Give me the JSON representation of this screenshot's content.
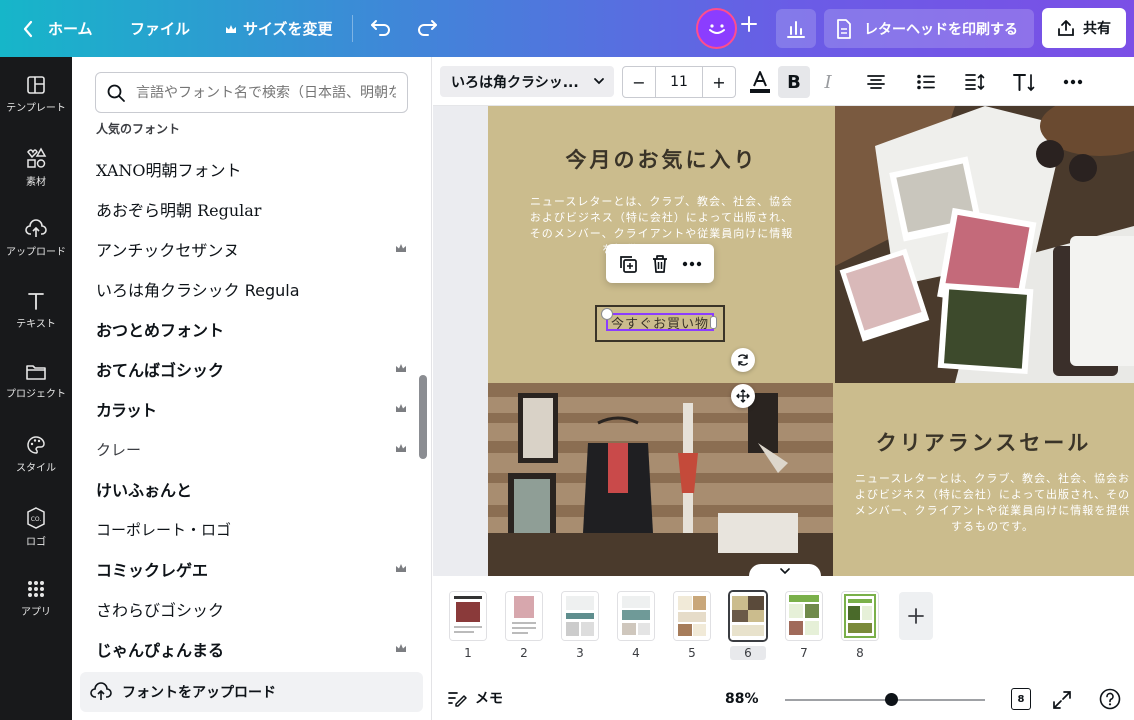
{
  "topbar": {
    "home_label": "ホーム",
    "file_label": "ファイル",
    "resize_label": "サイズを変更",
    "print_label": "レターヘッドを印刷する",
    "share_label": "共有"
  },
  "rail": {
    "items": [
      {
        "label": "テンプレート",
        "icon": "template-icon"
      },
      {
        "label": "素材",
        "icon": "elements-icon"
      },
      {
        "label": "アップロード",
        "icon": "upload-icon"
      },
      {
        "label": "テキスト",
        "icon": "text-icon"
      },
      {
        "label": "プロジェクト",
        "icon": "folder-icon"
      },
      {
        "label": "スタイル",
        "icon": "palette-icon"
      },
      {
        "label": "ロゴ",
        "icon": "logo-icon"
      },
      {
        "label": "アプリ",
        "icon": "apps-icon"
      }
    ]
  },
  "panel": {
    "search_placeholder": "言語やフォント名で検索（日本語、明朝なと",
    "section_title": "人気のフォント",
    "fonts": [
      {
        "name": "XANO明朝フォント",
        "premium": false
      },
      {
        "name": "あおぞら明朝 Regular",
        "premium": false
      },
      {
        "name": "アンチックセザンヌ",
        "premium": true
      },
      {
        "name": "いろは角クラシック Regula",
        "premium": false
      },
      {
        "name": "おつとめフォント",
        "premium": false
      },
      {
        "name": "おてんばゴシック",
        "premium": true
      },
      {
        "name": "カラット",
        "premium": true
      },
      {
        "name": "クレー",
        "premium": true
      },
      {
        "name": "けいふぉんと",
        "premium": false
      },
      {
        "name": "コーポレート・ロゴ",
        "premium": false
      },
      {
        "name": "コミックレゲエ",
        "premium": true
      },
      {
        "name": "さわらびゴシック",
        "premium": false
      },
      {
        "name": "じゃんぴょんまる",
        "premium": true
      }
    ],
    "upload_label": "フォントをアップロード"
  },
  "toolbar": {
    "font_name": "いろは角クラシッ...",
    "font_size": "11",
    "minus": "−",
    "plus": "+",
    "bold_label": "B",
    "italic_label": "I"
  },
  "canvas": {
    "heading1": "今月のお気に入り",
    "body1": "ニュースレターとは、クラブ、教会、社会、協会およびビジネス（特に会社）によって出版され、そのメンバー、クライアントや従業員向けに情報を提供するものです。",
    "cta": "今すぐお買い物",
    "heading2": "クリアランスセール",
    "body2": "ニュースレターとは、クラブ、教会、社会、協会およびビジネス（特に会社）によって出版され、そのメンバー、クライアントや従業員向けに情報を提供するものです。"
  },
  "pages": {
    "numbers": [
      "1",
      "2",
      "3",
      "4",
      "5",
      "6",
      "7",
      "8"
    ],
    "active": "6"
  },
  "bottombar": {
    "memo_label": "メモ",
    "zoom": "88%",
    "zoom_level": 0.53,
    "page_count": "8"
  },
  "colors": {
    "accent": "#8b3dff",
    "tan": "#cbbc8d",
    "rail_bg": "#18191b"
  }
}
